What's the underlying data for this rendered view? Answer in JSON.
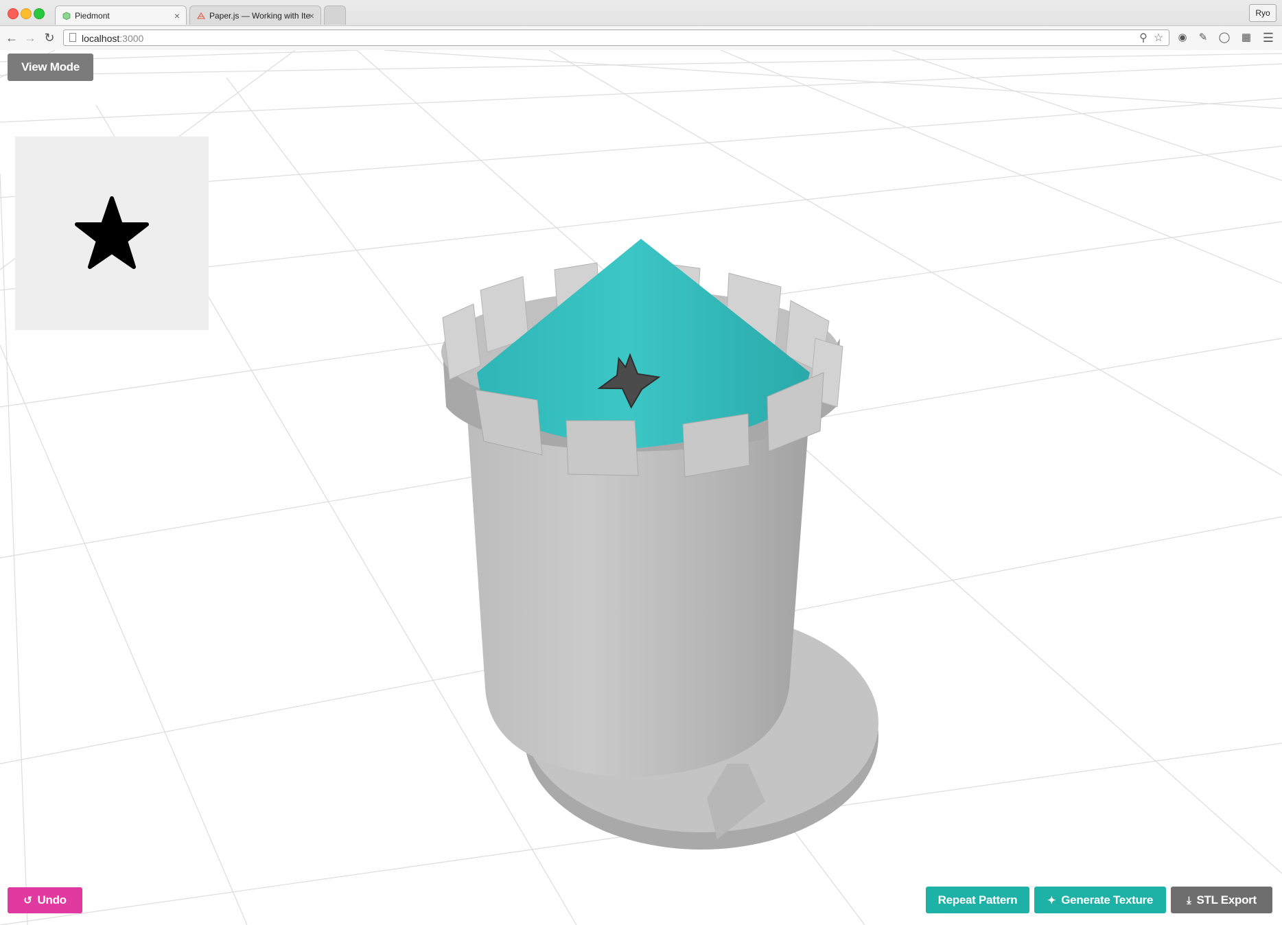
{
  "browser": {
    "tabs": [
      {
        "title": "Piedmont",
        "active": true
      },
      {
        "title": "Paper.js — Working with Ite",
        "active": false
      }
    ],
    "profile_name": "Ryo",
    "address": {
      "host": "localhost",
      "port": ":3000"
    }
  },
  "app": {
    "view_mode_label": "View Mode",
    "undo_label": "Undo",
    "repeat_pattern_label": "Repeat Pattern",
    "generate_texture_label": "Generate Texture",
    "stl_export_label": "STL Export",
    "pattern_shape": "star-icon"
  },
  "colors": {
    "accent_teal": "#1eb1a6",
    "undo_pink": "#e0399f",
    "neutral_gray": "#6e6e6e",
    "roof_teal": "#3cc4c4",
    "tower_gray": "#c6c6c6"
  }
}
